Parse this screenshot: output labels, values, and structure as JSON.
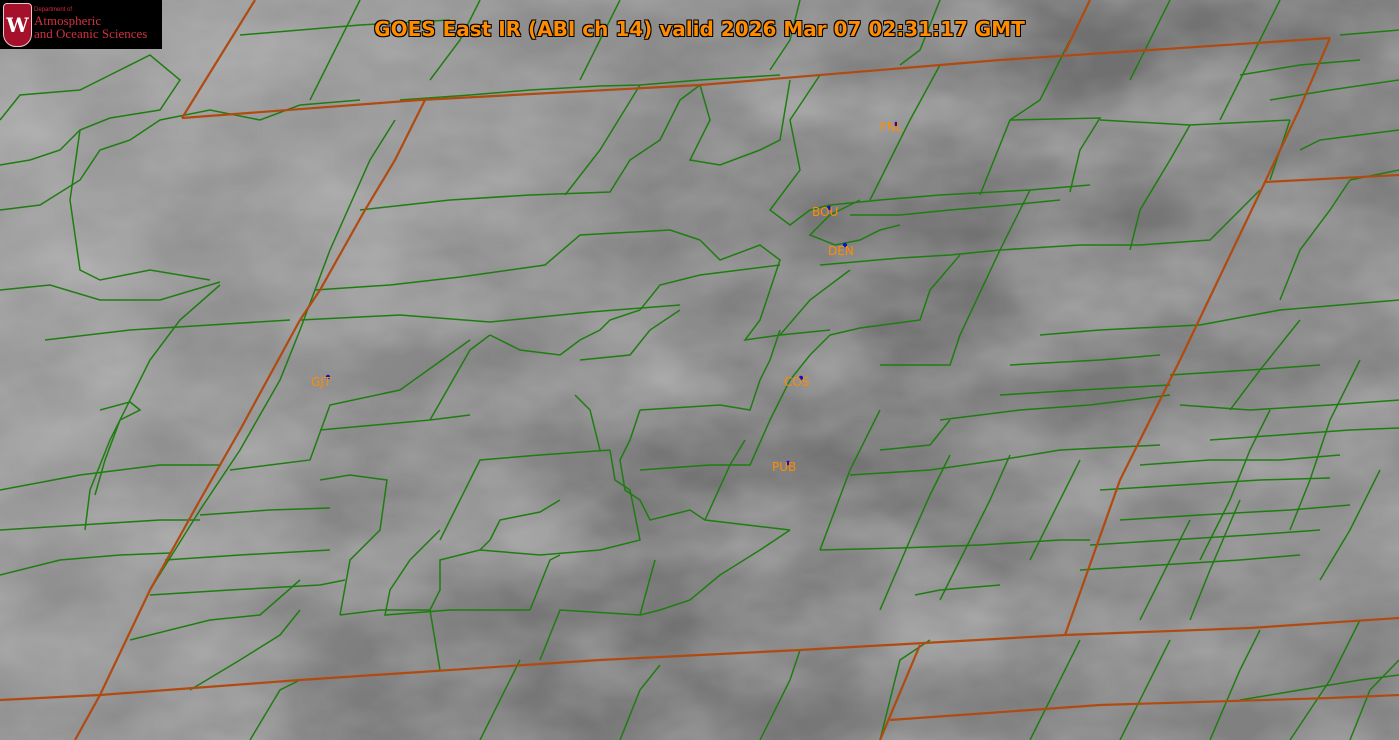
{
  "title": "GOES East IR (ABI ch 14) valid 2026 Mar 07 02:31:17 GMT",
  "logo": {
    "seal_letter": "W",
    "dept_small": "Department of",
    "dept_line1": "Atmospheric",
    "dept_line2": "and Oceanic Sciences"
  },
  "colors": {
    "title": "#ff8c00",
    "county_lines": "#1e7d10",
    "state_lines": "#b04a10",
    "station_labels": "#ff8c00",
    "station_markers": "#1010c8"
  },
  "stations": [
    {
      "id": "FNL"
    },
    {
      "id": "BOU"
    },
    {
      "id": "DEN"
    },
    {
      "id": "GJT"
    },
    {
      "id": "COS"
    },
    {
      "id": "PUB"
    }
  ]
}
